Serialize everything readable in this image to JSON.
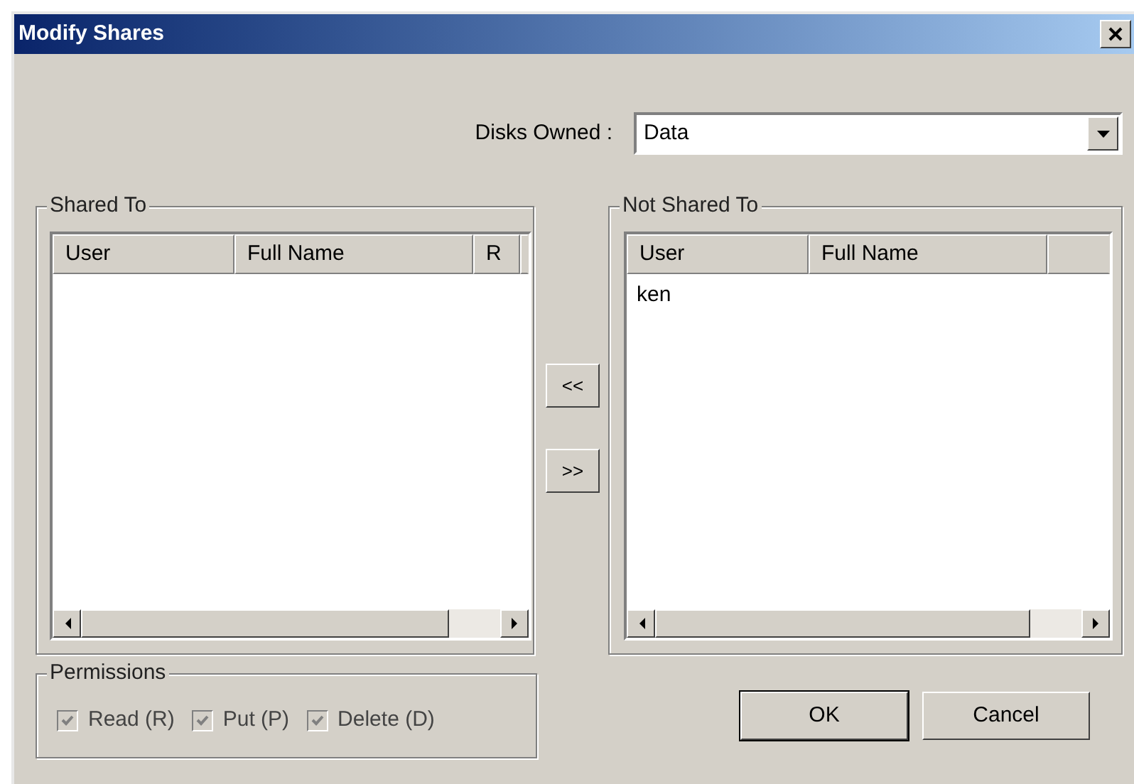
{
  "window": {
    "title": "Modify Shares"
  },
  "disks_owned": {
    "label": "Disks Owned :",
    "value": "Data"
  },
  "shared_to": {
    "title": "Shared To",
    "columns": [
      "User",
      "Full Name",
      "R"
    ]
  },
  "transfer_buttons": [
    "<<",
    ">>"
  ],
  "not_shared_to": {
    "title": "Not Shared To",
    "columns": [
      "User",
      "Full Name"
    ],
    "rows": [
      {
        "user": "ken",
        "selected": false
      }
    ]
  },
  "permissions": {
    "title": "Permissions",
    "items": [
      {
        "label": "Read (R)",
        "checked": true,
        "disabled": true
      },
      {
        "label": "Put (P)",
        "checked": true,
        "disabled": true
      },
      {
        "label": "Delete (D)",
        "checked": true,
        "disabled": true
      }
    ]
  },
  "buttons": [
    {
      "label": "OK",
      "default": true
    },
    {
      "label": "Cancel",
      "default": false
    }
  ]
}
